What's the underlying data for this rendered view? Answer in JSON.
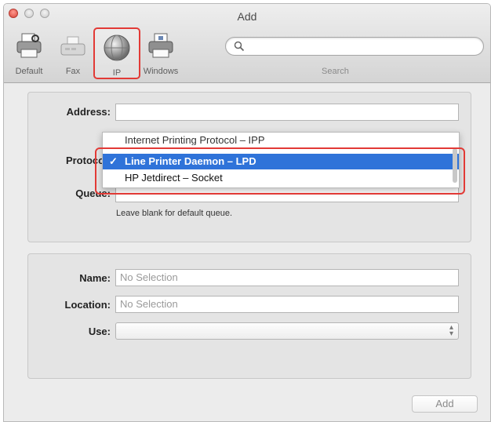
{
  "window": {
    "title": "Add"
  },
  "toolbar": {
    "items": [
      {
        "label": "Default",
        "icon": "printer-icon"
      },
      {
        "label": "Fax",
        "icon": "fax-icon"
      },
      {
        "label": "IP",
        "icon": "globe-icon"
      },
      {
        "label": "Windows",
        "icon": "windows-printer-icon"
      }
    ],
    "selected": "IP",
    "search": {
      "value": "",
      "placeholder": "",
      "label": "Search"
    }
  },
  "connection": {
    "address_label": "Address:",
    "address_value": "",
    "protocol_label": "Protocol:",
    "queue_label": "Queue:",
    "queue_hint": "Leave blank for default queue.",
    "protocol_menu": {
      "items": [
        "Internet Printing Protocol – IPP",
        "Line Printer Daemon – LPD",
        "HP Jetdirect – Socket"
      ],
      "selected": "Line Printer Daemon – LPD",
      "check_mark": "✓"
    }
  },
  "printer_info": {
    "name_label": "Name:",
    "name_value": "No Selection",
    "location_label": "Location:",
    "location_value": "No Selection",
    "use_label": "Use:",
    "use_value": ""
  },
  "footer": {
    "add_label": "Add"
  },
  "colors": {
    "highlight": "#e23a36",
    "selection": "#2f73d9"
  }
}
